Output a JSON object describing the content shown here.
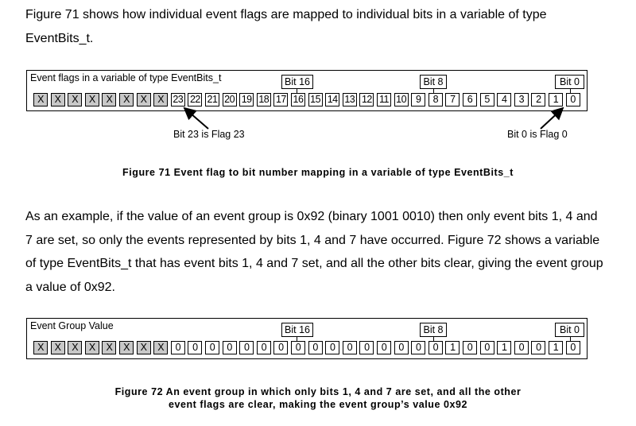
{
  "paragraphs": {
    "intro": "Figure 71 shows how individual event flags are mapped to individual bits in a variable of type EventBits_t.",
    "example": "As an example, if the value of an event group is 0x92 (binary 1001 0010) then only event bits 1, 4 and 7 are set, so only the events represented by bits 1, 4 and 7 have occurred.  Figure 72 shows a variable of type EventBits_t that has event bits 1, 4 and 7 set, and all the other bits clear, giving the event group a value of 0x92."
  },
  "figure71": {
    "box_title": "Event flags in a variable of type EventBits_t",
    "markers": [
      "Bit 16",
      "Bit 8",
      "Bit 0"
    ],
    "cells": [
      "X",
      "X",
      "X",
      "X",
      "X",
      "X",
      "X",
      "X",
      "23",
      "22",
      "21",
      "20",
      "19",
      "18",
      "17",
      "16",
      "15",
      "14",
      "13",
      "12",
      "11",
      "10",
      "9",
      "8",
      "7",
      "6",
      "5",
      "4",
      "3",
      "2",
      "1",
      "0"
    ],
    "annotation_left": "Bit 23 is Flag 23",
    "annotation_right": "Bit 0 is Flag 0",
    "caption": "Figure 71 Event flag to bit number mapping in a variable of type EventBits_t"
  },
  "figure72": {
    "box_title": "Event Group Value",
    "markers": [
      "Bit 16",
      "Bit 8",
      "Bit 0"
    ],
    "cells": [
      "X",
      "X",
      "X",
      "X",
      "X",
      "X",
      "X",
      "X",
      "0",
      "0",
      "0",
      "0",
      "0",
      "0",
      "0",
      "0",
      "0",
      "0",
      "0",
      "0",
      "0",
      "0",
      "0",
      "0",
      "1",
      "0",
      "0",
      "1",
      "0",
      "0",
      "1",
      "0"
    ],
    "caption_line1": "Figure 72 An event group in which only bits 1, 4 and 7 are set, and all the other",
    "caption_line2": "event flags are clear, making the event group’s value 0x92"
  }
}
